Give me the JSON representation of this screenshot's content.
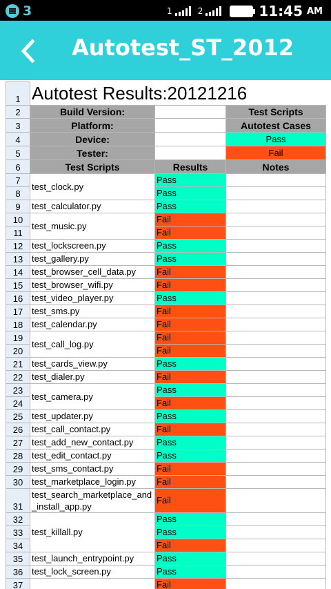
{
  "status_bar": {
    "notification_count": "3",
    "sim1_label": "1",
    "sim2_label": "2",
    "time": "11:45",
    "ampm": "AM"
  },
  "header": {
    "title": "Autotest_ST_2012",
    "back_icon": "chevron-left-icon"
  },
  "sheet": {
    "title": "Autotest Results:20121216",
    "info": {
      "build_version": "Build Version:",
      "platform": "Platform:",
      "device": "Device:",
      "tester": "Tester:"
    },
    "legend": {
      "test_scripts": "Test Scripts",
      "autotest_cases": "Autotest Cases",
      "pass": "Pass",
      "fail": "Fail"
    },
    "columns": {
      "test_scripts": "Test Scripts",
      "results": "Results",
      "notes": "Notes"
    },
    "scripts": [
      {
        "name": "test_clock.py",
        "results": [
          "Pass",
          "Pass"
        ]
      },
      {
        "name": "test_calculator.py",
        "results": [
          "Pass"
        ]
      },
      {
        "name": "test_music.py",
        "results": [
          "Fail",
          "Fail"
        ]
      },
      {
        "name": "test_lockscreen.py",
        "results": [
          "Pass"
        ]
      },
      {
        "name": "test_gallery.py",
        "results": [
          "Pass"
        ]
      },
      {
        "name": "test_browser_cell_data.py",
        "results": [
          "Fail"
        ]
      },
      {
        "name": "test_browser_wifi.py",
        "results": [
          "Fail"
        ]
      },
      {
        "name": "test_video_player.py",
        "results": [
          "Pass"
        ]
      },
      {
        "name": "test_sms.py",
        "results": [
          "Fail"
        ]
      },
      {
        "name": "test_calendar.py",
        "results": [
          "Fail"
        ]
      },
      {
        "name": "test_call_log.py",
        "results": [
          "Fail",
          "Fail"
        ]
      },
      {
        "name": "test_cards_view.py",
        "results": [
          "Pass"
        ]
      },
      {
        "name": "test_dialer.py",
        "results": [
          "Fail"
        ]
      },
      {
        "name": "test_camera.py",
        "results": [
          "Pass",
          "Fail"
        ]
      },
      {
        "name": "test_updater.py",
        "results": [
          "Pass"
        ]
      },
      {
        "name": "test_call_contact.py",
        "results": [
          "Fail"
        ]
      },
      {
        "name": "test_add_new_contact.py",
        "results": [
          "Pass"
        ]
      },
      {
        "name": "test_edit_contact.py",
        "results": [
          "Pass"
        ]
      },
      {
        "name": "test_sms_contact.py",
        "results": [
          "Fail"
        ]
      },
      {
        "name": "test_marketplace_login.py",
        "results": [
          "Fail"
        ]
      },
      {
        "name": "test_search_marketplace_and_install_app.py",
        "display_name": "test_search_marketplace_and _install_app.py",
        "results": [
          "Fail"
        ],
        "tall": true
      },
      {
        "name": "test_killall.py",
        "results": [
          "Pass",
          "Pass",
          "Fail"
        ]
      },
      {
        "name": "test_launch_entrypoint.py",
        "results": [
          "Pass"
        ]
      },
      {
        "name": "test_lock_screen.py",
        "results": [
          "Pass"
        ]
      },
      {
        "name": "",
        "results": [
          "Fail"
        ]
      }
    ]
  }
}
